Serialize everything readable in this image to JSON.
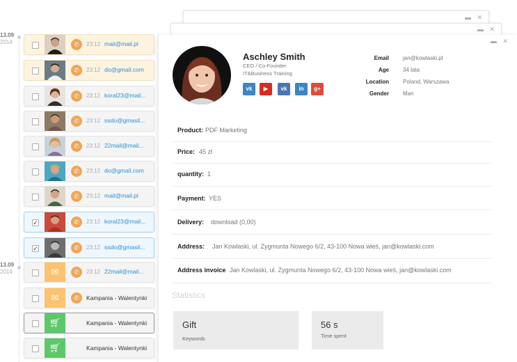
{
  "timeline": [
    {
      "date": "13.09",
      "year": "2014"
    },
    {
      "date": "13.09",
      "year": "2014"
    }
  ],
  "rows": [
    {
      "kind": "contact",
      "time": "23:12",
      "email": "mail@mail.pl",
      "state": "highlighted",
      "checked": false
    },
    {
      "kind": "contact",
      "time": "23:12",
      "email": "do@gmail.com",
      "state": "highlighted",
      "checked": false
    },
    {
      "kind": "contact",
      "time": "23:12",
      "email": "koral23@mail...",
      "state": "normal",
      "checked": false
    },
    {
      "kind": "contact",
      "time": "23:12",
      "email": "ssdo@gmasil...",
      "state": "normal",
      "checked": false
    },
    {
      "kind": "contact",
      "time": "23:12",
      "email": "22mail@mail...",
      "state": "normal",
      "checked": false
    },
    {
      "kind": "contact",
      "time": "23:12",
      "email": "do@gmail.com",
      "state": "normal",
      "checked": false
    },
    {
      "kind": "contact",
      "time": "23:12",
      "email": "mail@mail.pl",
      "state": "normal",
      "checked": false
    },
    {
      "kind": "contact",
      "time": "23:12",
      "email": "koral23@mail...",
      "state": "selected",
      "checked": true
    },
    {
      "kind": "contact",
      "time": "23:12",
      "email": "ssdo@gmasil...",
      "state": "selected",
      "checked": true
    },
    {
      "kind": "mail",
      "time": "23:12",
      "email": "22mail@mail...",
      "state": "normal",
      "checked": false
    },
    {
      "kind": "mail-campaign",
      "campaign": "Kampania - Walentynki",
      "state": "normal",
      "checked": false
    },
    {
      "kind": "cart",
      "campaign": "Kampania - Walentynki",
      "state": "dark",
      "checked": false
    },
    {
      "kind": "cart",
      "campaign": "Kampania - Walentynki",
      "state": "normal",
      "checked": false
    }
  ],
  "icons": {
    "phone": "phone-icon",
    "mail": "envelope-icon",
    "cart": "cart-icon",
    "folder": "folder-icon",
    "close": "close-icon",
    "checkbox": "checkbox"
  },
  "colors": {
    "accent_orange": "#f0a554",
    "mail_tile": "#fbc26f",
    "cart_tile": "#5dc86a",
    "link_blue": "#2a8fd4",
    "selected_border": "#a7d3ef",
    "highlight_bg": "#fdf3df"
  },
  "profile": {
    "name": "Aschley Smith",
    "role_line1": "CEO / Co-Founder",
    "role_line2": "IT&Business Training",
    "social": [
      {
        "name": "vk",
        "glyph": "vk",
        "color": "#3a86c8"
      },
      {
        "name": "youtube",
        "glyph": "▶",
        "color": "#d92b21"
      },
      {
        "name": "vk",
        "glyph": "vk",
        "color": "#4c75b3"
      },
      {
        "name": "linkedin",
        "glyph": "in",
        "color": "#3c86c4"
      },
      {
        "name": "google-plus",
        "glyph": "g+",
        "color": "#dd4b39"
      }
    ],
    "info": [
      {
        "label": "Email",
        "value": "jan@kowlaski.pl"
      },
      {
        "label": "Age",
        "value": "34 lata"
      },
      {
        "label": "Location",
        "value": "Poland, Warszawa"
      },
      {
        "label": "Gender",
        "value": "Man"
      }
    ]
  },
  "details": [
    {
      "label": "Product:",
      "value": "PDF Marketing"
    },
    {
      "label": "Price:",
      "value": "45 zł"
    },
    {
      "label": "quantity:",
      "value": "1"
    },
    {
      "label": "Payment:",
      "value": "YES"
    },
    {
      "label": "Delivery:",
      "value": "download (0,00)"
    },
    {
      "label": "Address:",
      "value": "Jan Kowlaski, ul. Zygmunta Nowego 6/2, 43-100 Nowa wieś, jan@kowlaski.com"
    },
    {
      "label": "Address invoice",
      "value": "Jan Kowlaski, ul. Zygmunta Nowego 6/2, 43-100 Nowa wieś, jan@kowlaski.com"
    }
  ],
  "statistics": {
    "title": "Statistics",
    "cards": [
      {
        "value": "Gift",
        "label": "Keywords"
      },
      {
        "value": "56 s",
        "label": "Time spent"
      }
    ]
  }
}
